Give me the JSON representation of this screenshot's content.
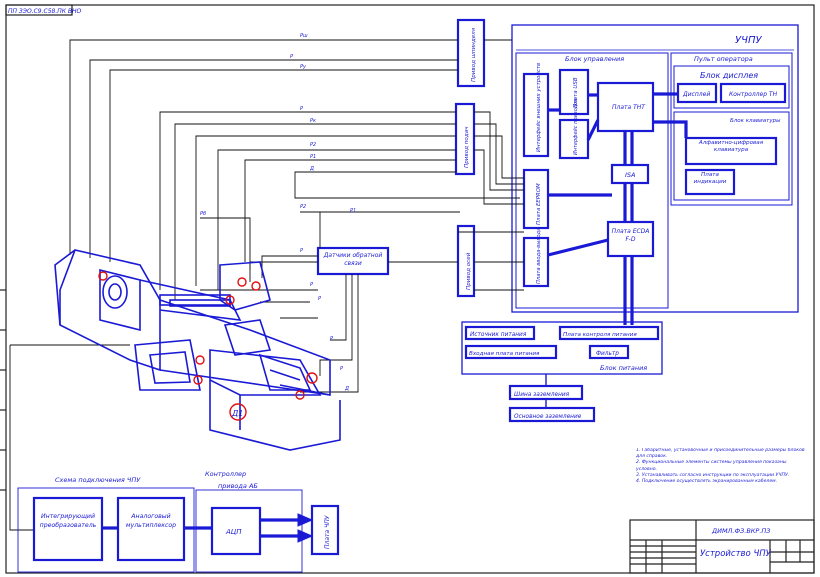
{
  "stamp_code": "ПП ЗЭО.С9.С58.ПК ВНО",
  "uchpu": {
    "title": "УЧПУ",
    "control_block": "Блок управления",
    "operator_panel": "Пульт оператора",
    "display_block": "Блок дисплея",
    "display": "Дисплей",
    "controller": "Контроллер ТН",
    "keyboard_block": "Блок клавиатуры",
    "alnum_keyboard": "Алфавитно-цифровая клавиатура",
    "indication_board": "Плата индикации",
    "board_tn": "Плата ТНТ",
    "board_usb": "Плата USB",
    "isa": "ISA",
    "board_ecda": "Плата ECDA F-D",
    "ext_interface": "Интерфейс внешних устройств",
    "eeprom": "Плата EEPROM",
    "drive_interface": "Интерфейс приводов",
    "io_board": "Плата ввода-вывода"
  },
  "power": {
    "title": "Блок питания",
    "source": "Источник питания",
    "input_board": "Входная плата питания",
    "bus": "Плата контроля питания",
    "filter": "Фильтр",
    "ground_bus": "Шина заземления",
    "protective_ground": "Основное заземление"
  },
  "feedback_sensors": "Датчики обратной связи",
  "spindle_drive": "Привод шпинделя",
  "axis_drive": "Привод осей",
  "servo_drive": "Привод подач",
  "block_diagram": {
    "caption": "Схема подключения ЧПУ",
    "controller_caption": "Контроллер",
    "controller_caption2": "привода АБ",
    "integrator": "Интегрирующий преобразователь",
    "analog": "Аналоговый мультиплексор",
    "adc": "АЦП",
    "cnc": "Плата ЧПУ"
  },
  "machine_labels": [
    "Д1"
  ],
  "notes": [
    "1. Габаритные, установочные и присоединительные размеры блоков для справок.",
    "2. Функциональные элементы системы управления показаны условно.",
    "3. Устанавливать согласно инструкции по эксплуатации УЧПУ.",
    "4. Подключение осуществлять экранированным кабелем."
  ],
  "title_block": {
    "doc_number": "ДИМЛ.ФЗ.ВКР.ПЗ",
    "doc_title": "Устройство ЧПУ"
  },
  "wire_labels": [
    "Рш",
    "Р",
    "Ру",
    "Р",
    "Рк",
    "Р2",
    "Р1",
    "Д",
    "Рб",
    "Р2",
    "Р1",
    "Р",
    "Р",
    "Р",
    "Р",
    "Р",
    "Д"
  ]
}
